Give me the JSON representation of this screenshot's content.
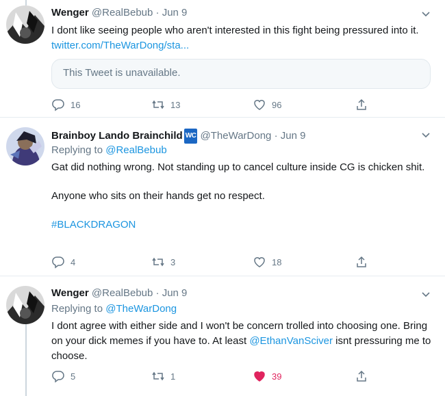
{
  "tweets": [
    {
      "name": "Wenger",
      "handle": "@RealBebub",
      "dot": "·",
      "date": "Jun 9",
      "text": "I dont like seeing people who aren't interested in this fight being pressured into it.",
      "link": "twitter.com/TheWarDong/sta...",
      "quote": "This Tweet is unavailable.",
      "replies": "16",
      "retweets": "13",
      "likes": "96"
    },
    {
      "name": "Brainboy Lando Brainchild",
      "badge": "WC",
      "handle": "@TheWarDong",
      "dot": "·",
      "date": "Jun 9",
      "replying_label": "Replying to",
      "replying_to": "@RealBebub",
      "line1": "Gat did nothing wrong.  Not standing up to cancel culture inside CG is chicken shit.",
      "line2": "Anyone who sits on their hands get no respect.",
      "hashtag": "#BLACKDRAGON",
      "replies": "4",
      "retweets": "3",
      "likes": "18"
    },
    {
      "name": "Wenger",
      "handle": "@RealBebub",
      "dot": "·",
      "date": "Jun 9",
      "replying_label": "Replying to",
      "replying_to": "@TheWarDong",
      "text_a": "I dont agree with either side and I won't be concern trolled into choosing one. Bring on your dick memes if you have to. At least",
      "mention": "@EthanVanSciver",
      "text_b": "isnt pressuring me to choose.",
      "replies": "5",
      "retweets": "1",
      "likes": "39",
      "liked": true
    }
  ],
  "colors": {
    "link": "#1b95e0",
    "muted": "#657786",
    "like_active": "#e0245e",
    "badge": "#1b67c3"
  }
}
